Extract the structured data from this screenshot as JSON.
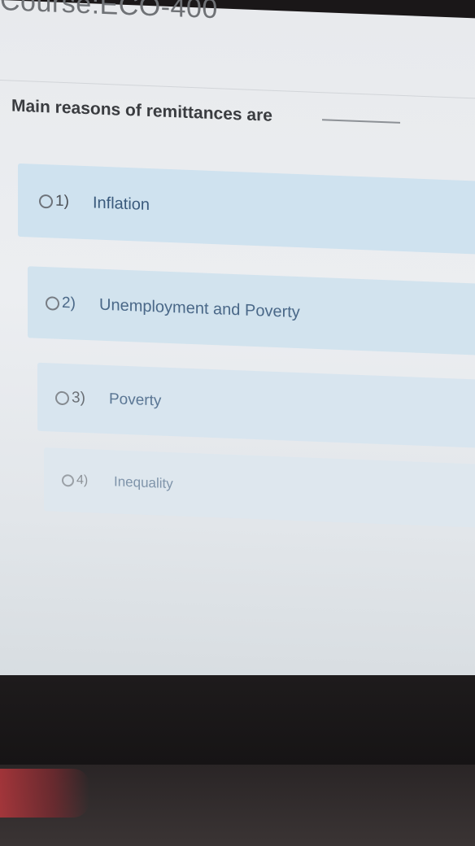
{
  "course": {
    "title": "Course:ECO-400"
  },
  "question": {
    "text": "Main reasons of remittances are"
  },
  "options": [
    {
      "number": "1)",
      "label": "Inflation"
    },
    {
      "number": "2)",
      "label": "Unemployment and Poverty"
    },
    {
      "number": "3)",
      "label": "Poverty"
    },
    {
      "number": "4)",
      "label": "Inequality"
    }
  ],
  "icons": {
    "radio": "radio-unselected-icon"
  },
  "colors": {
    "option_bg": "#cfe2ef",
    "option_text": "#3a5a7c"
  }
}
